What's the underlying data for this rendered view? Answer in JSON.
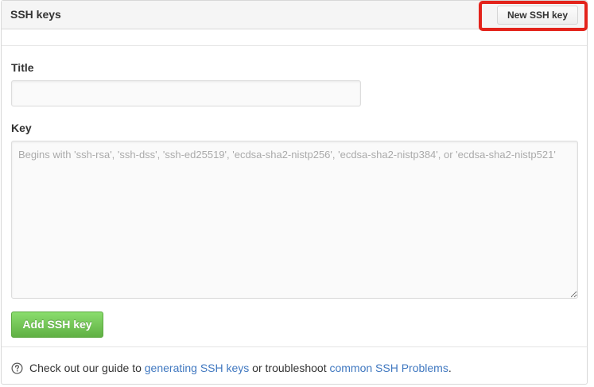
{
  "header": {
    "title": "SSH keys",
    "new_key_button_label": "New SSH key"
  },
  "form": {
    "title_label": "Title",
    "title_value": "",
    "key_label": "Key",
    "key_placeholder": "Begins with 'ssh-rsa', 'ssh-dss', 'ssh-ed25519', 'ecdsa-sha2-nistp256', 'ecdsa-sha2-nistp384', or 'ecdsa-sha2-nistp521'",
    "submit_label": "Add SSH key"
  },
  "footer": {
    "icon": "question-circle-icon",
    "text_before": "Check out our guide to ",
    "link1_label": "generating SSH keys",
    "text_middle": " or troubleshoot ",
    "link2_label": "common SSH Problems",
    "text_after": "."
  },
  "colors": {
    "highlight": "#e3231b",
    "primary_button": "#60b044",
    "link": "#4078c0"
  }
}
